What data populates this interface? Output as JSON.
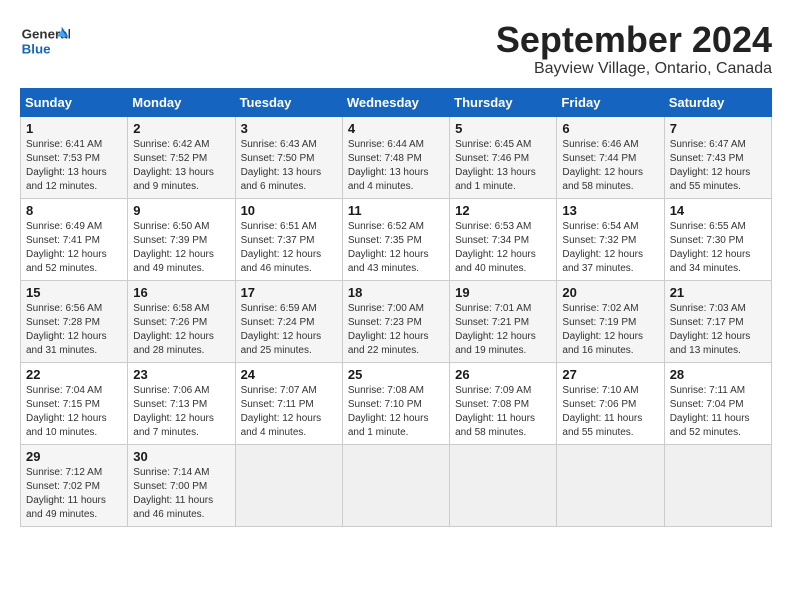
{
  "logo": {
    "general": "General",
    "blue": "Blue"
  },
  "title": "September 2024",
  "location": "Bayview Village, Ontario, Canada",
  "days_of_week": [
    "Sunday",
    "Monday",
    "Tuesday",
    "Wednesday",
    "Thursday",
    "Friday",
    "Saturday"
  ],
  "weeks": [
    [
      {
        "day": "1",
        "sunrise": "6:41 AM",
        "sunset": "7:53 PM",
        "daylight": "13 hours and 12 minutes"
      },
      {
        "day": "2",
        "sunrise": "6:42 AM",
        "sunset": "7:52 PM",
        "daylight": "13 hours and 9 minutes"
      },
      {
        "day": "3",
        "sunrise": "6:43 AM",
        "sunset": "7:50 PM",
        "daylight": "13 hours and 6 minutes"
      },
      {
        "day": "4",
        "sunrise": "6:44 AM",
        "sunset": "7:48 PM",
        "daylight": "13 hours and 4 minutes"
      },
      {
        "day": "5",
        "sunrise": "6:45 AM",
        "sunset": "7:46 PM",
        "daylight": "13 hours and 1 minute"
      },
      {
        "day": "6",
        "sunrise": "6:46 AM",
        "sunset": "7:44 PM",
        "daylight": "12 hours and 58 minutes"
      },
      {
        "day": "7",
        "sunrise": "6:47 AM",
        "sunset": "7:43 PM",
        "daylight": "12 hours and 55 minutes"
      }
    ],
    [
      {
        "day": "8",
        "sunrise": "6:49 AM",
        "sunset": "7:41 PM",
        "daylight": "12 hours and 52 minutes"
      },
      {
        "day": "9",
        "sunrise": "6:50 AM",
        "sunset": "7:39 PM",
        "daylight": "12 hours and 49 minutes"
      },
      {
        "day": "10",
        "sunrise": "6:51 AM",
        "sunset": "7:37 PM",
        "daylight": "12 hours and 46 minutes"
      },
      {
        "day": "11",
        "sunrise": "6:52 AM",
        "sunset": "7:35 PM",
        "daylight": "12 hours and 43 minutes"
      },
      {
        "day": "12",
        "sunrise": "6:53 AM",
        "sunset": "7:34 PM",
        "daylight": "12 hours and 40 minutes"
      },
      {
        "day": "13",
        "sunrise": "6:54 AM",
        "sunset": "7:32 PM",
        "daylight": "12 hours and 37 minutes"
      },
      {
        "day": "14",
        "sunrise": "6:55 AM",
        "sunset": "7:30 PM",
        "daylight": "12 hours and 34 minutes"
      }
    ],
    [
      {
        "day": "15",
        "sunrise": "6:56 AM",
        "sunset": "7:28 PM",
        "daylight": "12 hours and 31 minutes"
      },
      {
        "day": "16",
        "sunrise": "6:58 AM",
        "sunset": "7:26 PM",
        "daylight": "12 hours and 28 minutes"
      },
      {
        "day": "17",
        "sunrise": "6:59 AM",
        "sunset": "7:24 PM",
        "daylight": "12 hours and 25 minutes"
      },
      {
        "day": "18",
        "sunrise": "7:00 AM",
        "sunset": "7:23 PM",
        "daylight": "12 hours and 22 minutes"
      },
      {
        "day": "19",
        "sunrise": "7:01 AM",
        "sunset": "7:21 PM",
        "daylight": "12 hours and 19 minutes"
      },
      {
        "day": "20",
        "sunrise": "7:02 AM",
        "sunset": "7:19 PM",
        "daylight": "12 hours and 16 minutes"
      },
      {
        "day": "21",
        "sunrise": "7:03 AM",
        "sunset": "7:17 PM",
        "daylight": "12 hours and 13 minutes"
      }
    ],
    [
      {
        "day": "22",
        "sunrise": "7:04 AM",
        "sunset": "7:15 PM",
        "daylight": "12 hours and 10 minutes"
      },
      {
        "day": "23",
        "sunrise": "7:06 AM",
        "sunset": "7:13 PM",
        "daylight": "12 hours and 7 minutes"
      },
      {
        "day": "24",
        "sunrise": "7:07 AM",
        "sunset": "7:11 PM",
        "daylight": "12 hours and 4 minutes"
      },
      {
        "day": "25",
        "sunrise": "7:08 AM",
        "sunset": "7:10 PM",
        "daylight": "12 hours and 1 minute"
      },
      {
        "day": "26",
        "sunrise": "7:09 AM",
        "sunset": "7:08 PM",
        "daylight": "11 hours and 58 minutes"
      },
      {
        "day": "27",
        "sunrise": "7:10 AM",
        "sunset": "7:06 PM",
        "daylight": "11 hours and 55 minutes"
      },
      {
        "day": "28",
        "sunrise": "7:11 AM",
        "sunset": "7:04 PM",
        "daylight": "11 hours and 52 minutes"
      }
    ],
    [
      {
        "day": "29",
        "sunrise": "7:12 AM",
        "sunset": "7:02 PM",
        "daylight": "11 hours and 49 minutes"
      },
      {
        "day": "30",
        "sunrise": "7:14 AM",
        "sunset": "7:00 PM",
        "daylight": "11 hours and 46 minutes"
      },
      null,
      null,
      null,
      null,
      null
    ]
  ]
}
